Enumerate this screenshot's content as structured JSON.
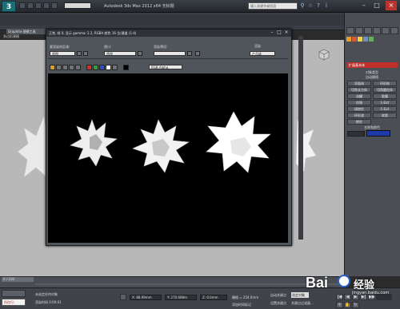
{
  "titlebar": {
    "logo": "3",
    "title": "Autodesk 3ds Max  2012 x64    无标题",
    "search_placeholder": "键入关键字或短语"
  },
  "ribbon": {
    "tab_label": "Graphite 建模工具",
    "sub_label": "多边形建模"
  },
  "render_window": {
    "title": "正常, 帧 0, 显示 gamma: 2.2, RGBA 颜色 16 位/通道 (1:4)",
    "area_label": "要渲染的区域:",
    "area_value": "视图",
    "viewport_label": "视口:",
    "viewport_value": "透视",
    "preset_label": "渲染预设:",
    "preset_value": "",
    "render_button": "渲染",
    "product_value": "产品级",
    "channel_value": "RGB Alpha"
  },
  "command_panel": {
    "dropdown": "扩展基本体",
    "object_type_header": "对象类型",
    "autogrid": "自动栅格",
    "buttons": [
      "异面体",
      "环形结",
      "切角长方体",
      "切角圆柱体",
      "油罐",
      "胶囊",
      "纺锤",
      "L-Ext",
      "球棱柱",
      "C-Ext",
      "环形波",
      "软管",
      "棱柱"
    ],
    "name_color_header": "名称和颜色",
    "swatch_color": "#1e3aa8"
  },
  "timeline": {
    "slider": "0 / 100"
  },
  "status_bar": {
    "maxscript": "所在行:",
    "prompt_top": "未选定任何对象",
    "prompt_bottom": "渲染时间 0:00:01",
    "x_value": "X: 88.99mm",
    "y_value": "Y: 270.698m",
    "z_value": "Z: 0.0mm",
    "grid_value": "栅格 = 254.0mm",
    "add_time_tag": "添加时间标记",
    "auto_key": "自动关键点",
    "set_key": "设置关键点",
    "selected_object": "选定对象",
    "key_filter": "关键点过滤器..."
  },
  "watermark": {
    "text": "Bai",
    "suffix": "经验",
    "url": "jingyan.baidu.com"
  }
}
